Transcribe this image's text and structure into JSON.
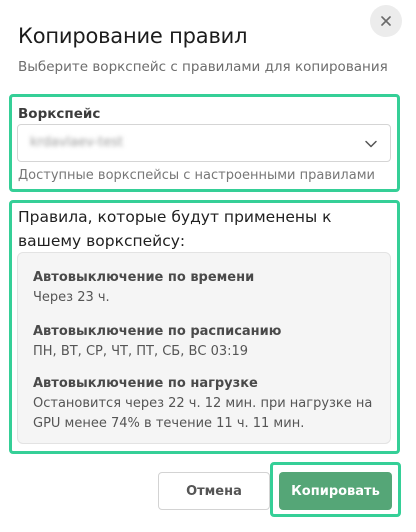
{
  "dialog": {
    "title": "Копирование правил",
    "subtitle": "Выберите воркспейс с правилами для копирования",
    "close_icon": "close-icon"
  },
  "workspace": {
    "label": "Воркспейс",
    "value": "krdavlaev-test",
    "helper": "Доступные воркспейсы с настроенными правилами",
    "dropdown_icon": "chevron-down-icon"
  },
  "rules": {
    "heading": "Правила, которые будут применены к вашему воркспейсу:",
    "items": [
      {
        "title": "Автовыключение по времени",
        "text": "Через 23 ч."
      },
      {
        "title": "Автовыключение по расписанию",
        "text": "ПН, ВТ, СР, ЧТ, ПТ, СБ, ВС 03:19"
      },
      {
        "title": "Автовыключение по нагрузке",
        "text": "Остановится через 22 ч. 12 мин. при нагрузке на GPU менее 74% в течение 11 ч. 11 мин."
      }
    ]
  },
  "actions": {
    "cancel_label": "Отмена",
    "copy_label": "Копировать"
  },
  "colors": {
    "highlight": "#35cf97",
    "primary_button": "#55a677",
    "card_background": "#f5f5f5"
  }
}
